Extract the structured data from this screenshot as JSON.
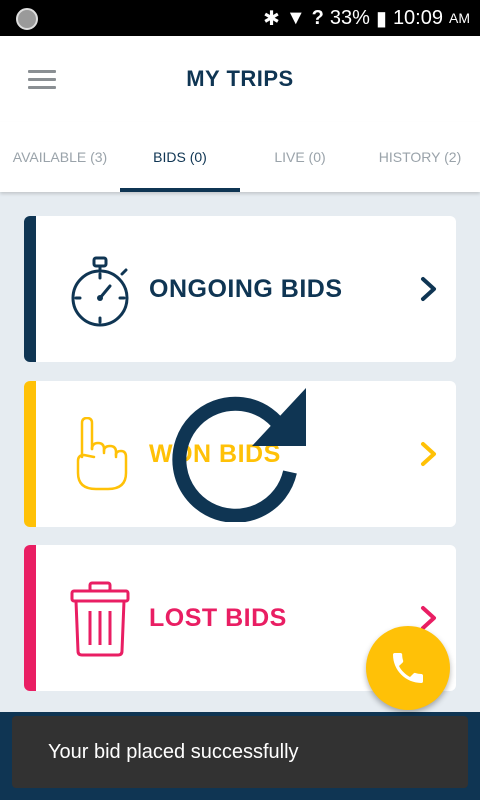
{
  "status_bar": {
    "battery": "33%",
    "time": "10:09",
    "ampm": "AM"
  },
  "header": {
    "title": "MY TRIPS"
  },
  "tabs": [
    {
      "label": "AVAILABLE (3)",
      "active": false
    },
    {
      "label": "BIDS (0)",
      "active": true
    },
    {
      "label": "LIVE (0)",
      "active": false
    },
    {
      "label": "HISTORY (2)",
      "active": false
    }
  ],
  "cards": [
    {
      "label": "ONGOING BIDS",
      "color": "#0f3553",
      "icon": "stopwatch-icon"
    },
    {
      "label": "WON BIDS",
      "color": "#ffc107",
      "icon": "thumbs-up-hand-icon"
    },
    {
      "label": "LOST BIDS",
      "color": "#e91e63",
      "icon": "trash-icon"
    }
  ],
  "snackbar": {
    "message": "Your bid placed successfully"
  },
  "colors": {
    "primary": "#0f3553",
    "accent": "#ffc107",
    "danger": "#e91e63"
  }
}
